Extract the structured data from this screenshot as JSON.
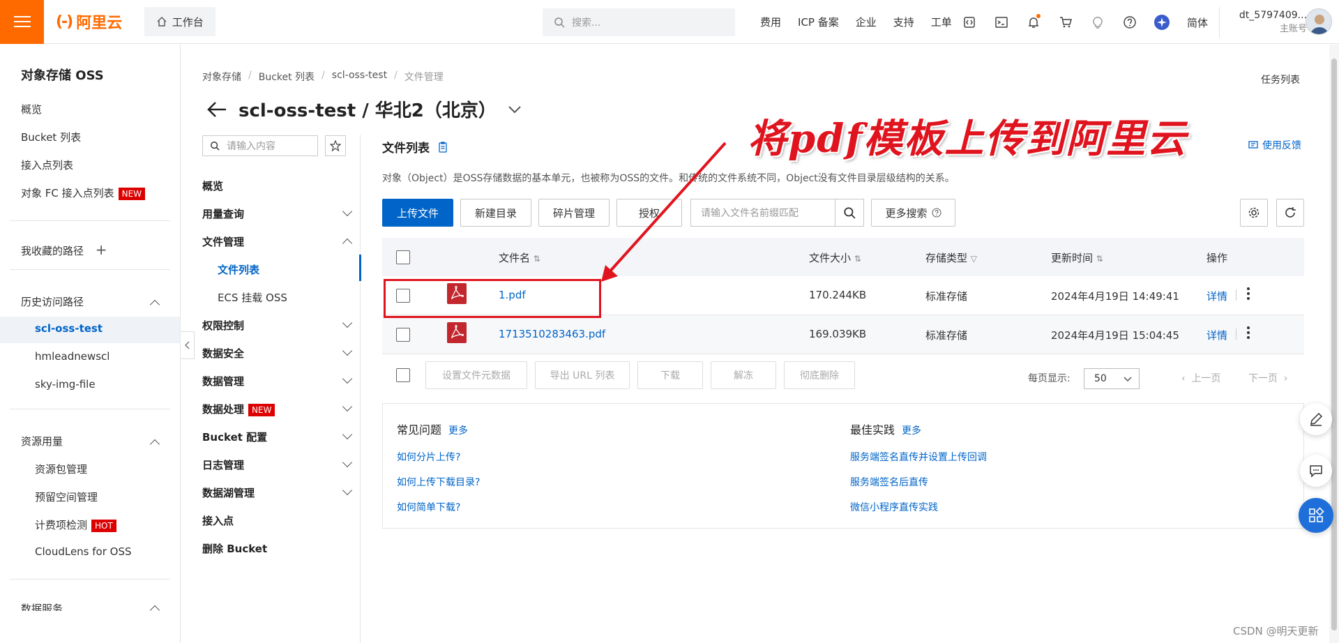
{
  "topbar": {
    "logo": "阿里云",
    "workbench": "工作台",
    "search_placeholder": "搜索...",
    "links": [
      "费用",
      "ICP 备案",
      "企业",
      "支持",
      "工单"
    ],
    "lang": "简体",
    "user_name": "dt_5797409...",
    "user_role": "主账号"
  },
  "sidebar": {
    "title": "对象存储 OSS",
    "items": [
      "概览",
      "Bucket 列表",
      "接入点列表",
      "对象 FC 接入点列表"
    ],
    "new_badge": "NEW",
    "favorites": "我收藏的路径",
    "history_title": "历史访问路径",
    "history": [
      "scl-oss-test",
      "hmleadnewscl",
      "sky-img-file"
    ],
    "resource_title": "资源用量",
    "resource_items": [
      "资源包管理",
      "预留空间管理",
      "计费项检测",
      "CloudLens for OSS"
    ],
    "hot_badge": "HOT",
    "data_service": "数据服务"
  },
  "breadcrumb": [
    "对象存储",
    "Bucket 列表",
    "scl-oss-test",
    "文件管理"
  ],
  "page_title": "scl-oss-test / 华北2（北京）",
  "task_list": "任务列表",
  "nav2": {
    "search_placeholder": "请输入内容",
    "items": [
      "概览",
      "用量查询",
      "文件管理",
      "文件列表",
      "ECS 挂载 OSS",
      "权限控制",
      "数据安全",
      "数据管理",
      "数据处理",
      "Bucket 配置",
      "日志管理",
      "数据湖管理",
      "接入点",
      "删除 Bucket"
    ],
    "new_badge": "NEW"
  },
  "main": {
    "title": "文件列表",
    "description": "对象（Object）是OSS存储数据的基本单元，也被称为OSS的文件。和传统的文件系统不同，Object没有文件目录层级结构的关系。",
    "feedback": "使用反馈",
    "buttons": [
      "上传文件",
      "新建目录",
      "碎片管理",
      "授权"
    ],
    "file_search_placeholder": "请输入文件名前缀匹配",
    "more_search": "更多搜索",
    "columns": [
      "文件名",
      "文件大小",
      "存储类型",
      "更新时间",
      "操作"
    ],
    "rows": [
      {
        "name": "1.pdf",
        "size": "170.244KB",
        "type": "标准存储",
        "time": "2024年4月19日 14:49:41",
        "action": "详情"
      },
      {
        "name": "1713510283463.pdf",
        "size": "169.039KB",
        "type": "标准存储",
        "time": "2024年4月19日 15:04:45",
        "action": "详情"
      }
    ],
    "bulk_buttons": [
      "设置文件元数据",
      "导出 URL 列表",
      "下载",
      "解冻",
      "彻底删除"
    ],
    "per_page_label": "每页显示:",
    "per_page_value": "50",
    "prev": "上一页",
    "next": "下一页"
  },
  "faq": {
    "title": "常见问题",
    "more": "更多",
    "links": [
      "如何分片上传?",
      "如何上传下载目录?",
      "如何简单下载?"
    ],
    "best_title": "最佳实践",
    "best_more": "更多",
    "best_links": [
      "服务端签名直传并设置上传回调",
      "服务端签名后直传",
      "微信小程序直传实践"
    ]
  },
  "annotation": "将pdf模板上传到阿里云",
  "watermark": "CSDN @明天更新"
}
